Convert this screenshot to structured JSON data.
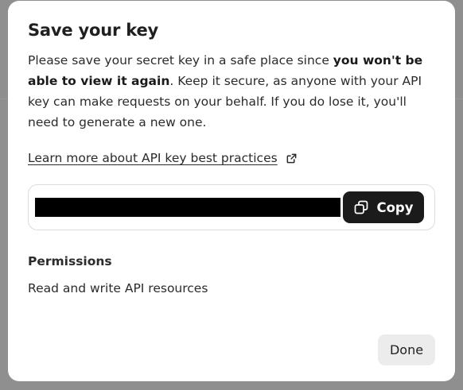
{
  "dialog": {
    "title": "Save your key",
    "description_part1": "Please save your secret key in a safe place since ",
    "description_bold": "you won't be able to view it again",
    "description_part2": ". Keep it secure, as anyone with your API key can make requests on your behalf. If you do lose it, you'll need to generate a new one.",
    "learn_more_link": "Learn more about API key best practices",
    "learn_more_icon": "external-link-icon",
    "key_field": {
      "value_hidden": true,
      "copy_button_label": "Copy",
      "copy_icon": "copy-icon"
    },
    "permissions": {
      "heading": "Permissions",
      "value": "Read and write API resources"
    },
    "done_button_label": "Done"
  }
}
